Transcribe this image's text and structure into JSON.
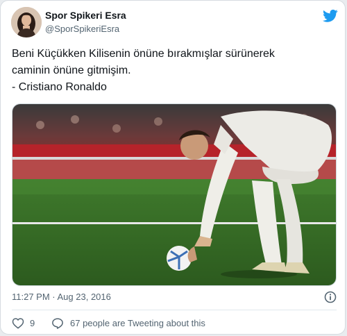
{
  "author": {
    "display_name": "Spor Spikeri Esra",
    "handle": "@SporSpikeriEsra"
  },
  "tweet": {
    "lines": [
      "Beni Küçükken Kilisenin önüne bırakmışlar sürünerek",
      "caminin önüne gitmişim.",
      "- Cristiano Ronaldo"
    ],
    "timestamp": "11:27 PM · Aug 23, 2016"
  },
  "stats": {
    "likes": "9",
    "tweeting_text": "67 people are Tweeting about this"
  },
  "icons": {
    "brand": "twitter-bird-icon",
    "info": "info-icon",
    "like": "heart-icon",
    "reply": "speech-bubble-icon"
  },
  "colors": {
    "twitter_blue": "#1d9bf0",
    "secondary_text": "#536471",
    "primary_text": "#0f1419"
  }
}
